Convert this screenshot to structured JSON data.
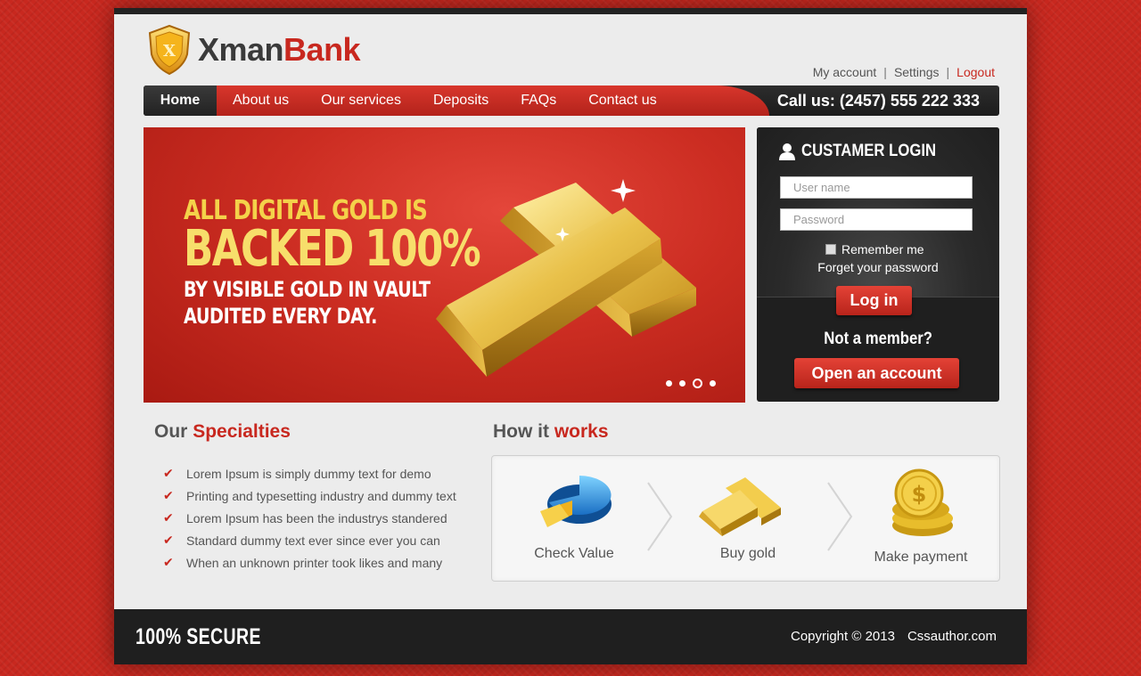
{
  "brand": {
    "logo_letter": "X",
    "name_part1": "Xman",
    "name_part2": "Bank",
    "accent_color": "#c8281f",
    "gold_color": "#f4d24a"
  },
  "toplinks": {
    "my_account": "My account",
    "sep": "|",
    "settings": "Settings",
    "logout": "Logout"
  },
  "nav": {
    "home": "Home",
    "items": [
      "About us",
      "Our services",
      "Deposits",
      "FAQs",
      "Contact us"
    ],
    "call_us": "Call us: (2457) 555 222 333"
  },
  "hero": {
    "line1": "ALL DIGITAL GOLD IS",
    "line2": "BACKED 100%",
    "line3": "BY VISIBLE GOLD IN VAULT",
    "line4": "AUDITED EVERY DAY.",
    "slide_count": 4,
    "active_slide": 3
  },
  "login": {
    "title": "CUSTAMER LOGIN",
    "username_placeholder": "User name",
    "password_placeholder": "Password",
    "remember": "Remember me",
    "forget": "Forget your password",
    "login_button": "Log in",
    "not_member": "Not a member?",
    "open_account": "Open an account"
  },
  "specialties": {
    "title_part1": "Our",
    "title_part2": "Specialties",
    "items": [
      "Lorem Ipsum is simply dummy text for demo",
      "Printing and typesetting industry and dummy text",
      "Lorem Ipsum has been the industrys standered",
      "Standard dummy text ever since  ever you can",
      "When an unknown printer took likes and many"
    ]
  },
  "how": {
    "title_part1": "How it",
    "title_part2": "works",
    "steps": [
      {
        "label": "Check Value",
        "icon": "pie-chart-icon"
      },
      {
        "label": "Buy gold",
        "icon": "gold-bars-icon"
      },
      {
        "label": "Make payment",
        "icon": "coins-icon"
      }
    ]
  },
  "footer": {
    "secure": "100% SECURE",
    "copyright": "Copyright © 2013",
    "site": "Cssauthor.com"
  }
}
